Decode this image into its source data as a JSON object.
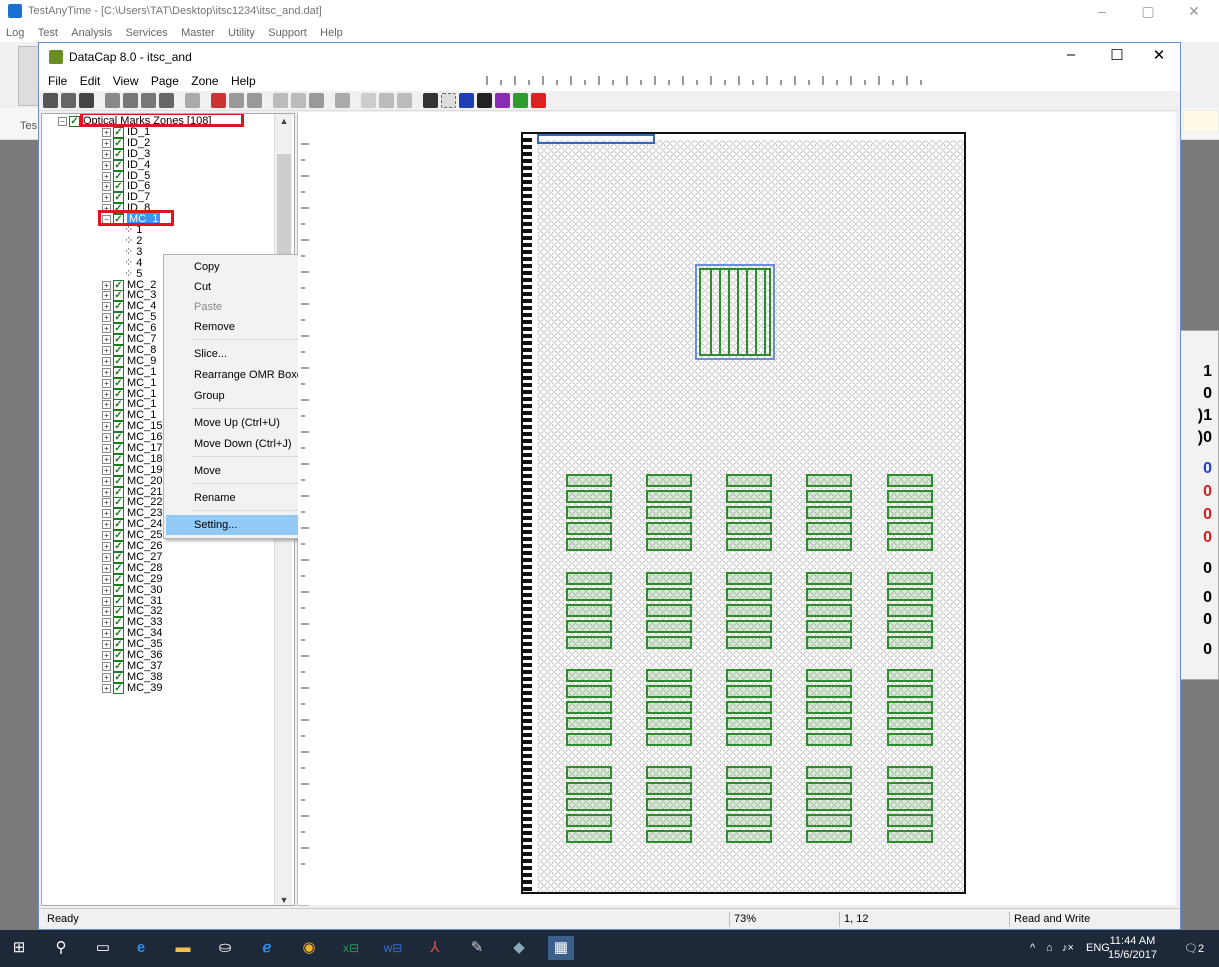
{
  "outer": {
    "title": "TestAnyTime - [C:\\Users\\TAT\\Desktop\\itsc1234\\itsc_and.dat]",
    "menu": [
      "Log",
      "Test",
      "Analysis",
      "Services",
      "Master",
      "Utility",
      "Support",
      "Help"
    ],
    "strip_label": "Tes",
    "side_values": [
      {
        "text": "1",
        "color": "#000000"
      },
      {
        "text": "0",
        "color": "#000000"
      },
      {
        "text": ")1",
        "color": "#000000"
      },
      {
        "text": ")0",
        "color": "#000000"
      },
      {
        "text": "0",
        "color": "#1f3fd0"
      },
      {
        "text": "0",
        "color": "#d01f1f"
      },
      {
        "text": "0",
        "color": "#d01f1f"
      },
      {
        "text": "0",
        "color": "#d01f1f"
      },
      {
        "text": "0",
        "color": "#000000"
      },
      {
        "text": "0",
        "color": "#000000"
      },
      {
        "text": "0",
        "color": "#000000"
      },
      {
        "text": "0",
        "color": "#000000"
      }
    ]
  },
  "datacap": {
    "title": "DataCap 8.0 - itsc_and",
    "menu": [
      "File",
      "Edit",
      "View",
      "Page",
      "Zone",
      "Help"
    ],
    "tree": {
      "root_label": "Optical Marks Zones [108]",
      "id_items": [
        "ID_1",
        "ID_2",
        "ID_3",
        "ID_4",
        "ID_5",
        "ID_6",
        "ID_7",
        "ID_8"
      ],
      "selected_label": "MC_1",
      "children": [
        "1",
        "2",
        "3",
        "4",
        "5"
      ],
      "mc_items_partial": [
        "MC_2",
        "MC_3",
        "MC_4",
        "MC_5",
        "MC_6",
        "MC_7",
        "MC_8",
        "MC_9",
        "MC_1",
        "MC_1",
        "MC_1",
        "MC_1",
        "MC_1",
        "MC_15"
      ],
      "mc_items": [
        "MC_16",
        "MC_17",
        "MC_18",
        "MC_19",
        "MC_20",
        "MC_21",
        "MC_22",
        "MC_23",
        "MC_24",
        "MC_25",
        "MC_26",
        "MC_27",
        "MC_28",
        "MC_29",
        "MC_30",
        "MC_31",
        "MC_32",
        "MC_33",
        "MC_34",
        "MC_35",
        "MC_36",
        "MC_37",
        "MC_38",
        "MC_39"
      ]
    },
    "context_menu": {
      "copy": "Copy",
      "cut": "Cut",
      "paste": "Paste",
      "remove": "Remove",
      "slice": "Slice...",
      "rearrange": "Rearrange OMR Boxes",
      "group": "Group",
      "move_up": "Move Up (Ctrl+U)",
      "move_down": "Move Down (Ctrl+J)",
      "move": "Move",
      "rename": "Rename",
      "setting": "Setting..."
    },
    "status": {
      "state": "Ready",
      "zoom": "73%",
      "coords": "1, 12",
      "mode": "Read and Write"
    }
  },
  "taskbar": {
    "time": "11:44 AM",
    "date": "15/6/2017",
    "lang": "ENG",
    "notifications": "2"
  }
}
